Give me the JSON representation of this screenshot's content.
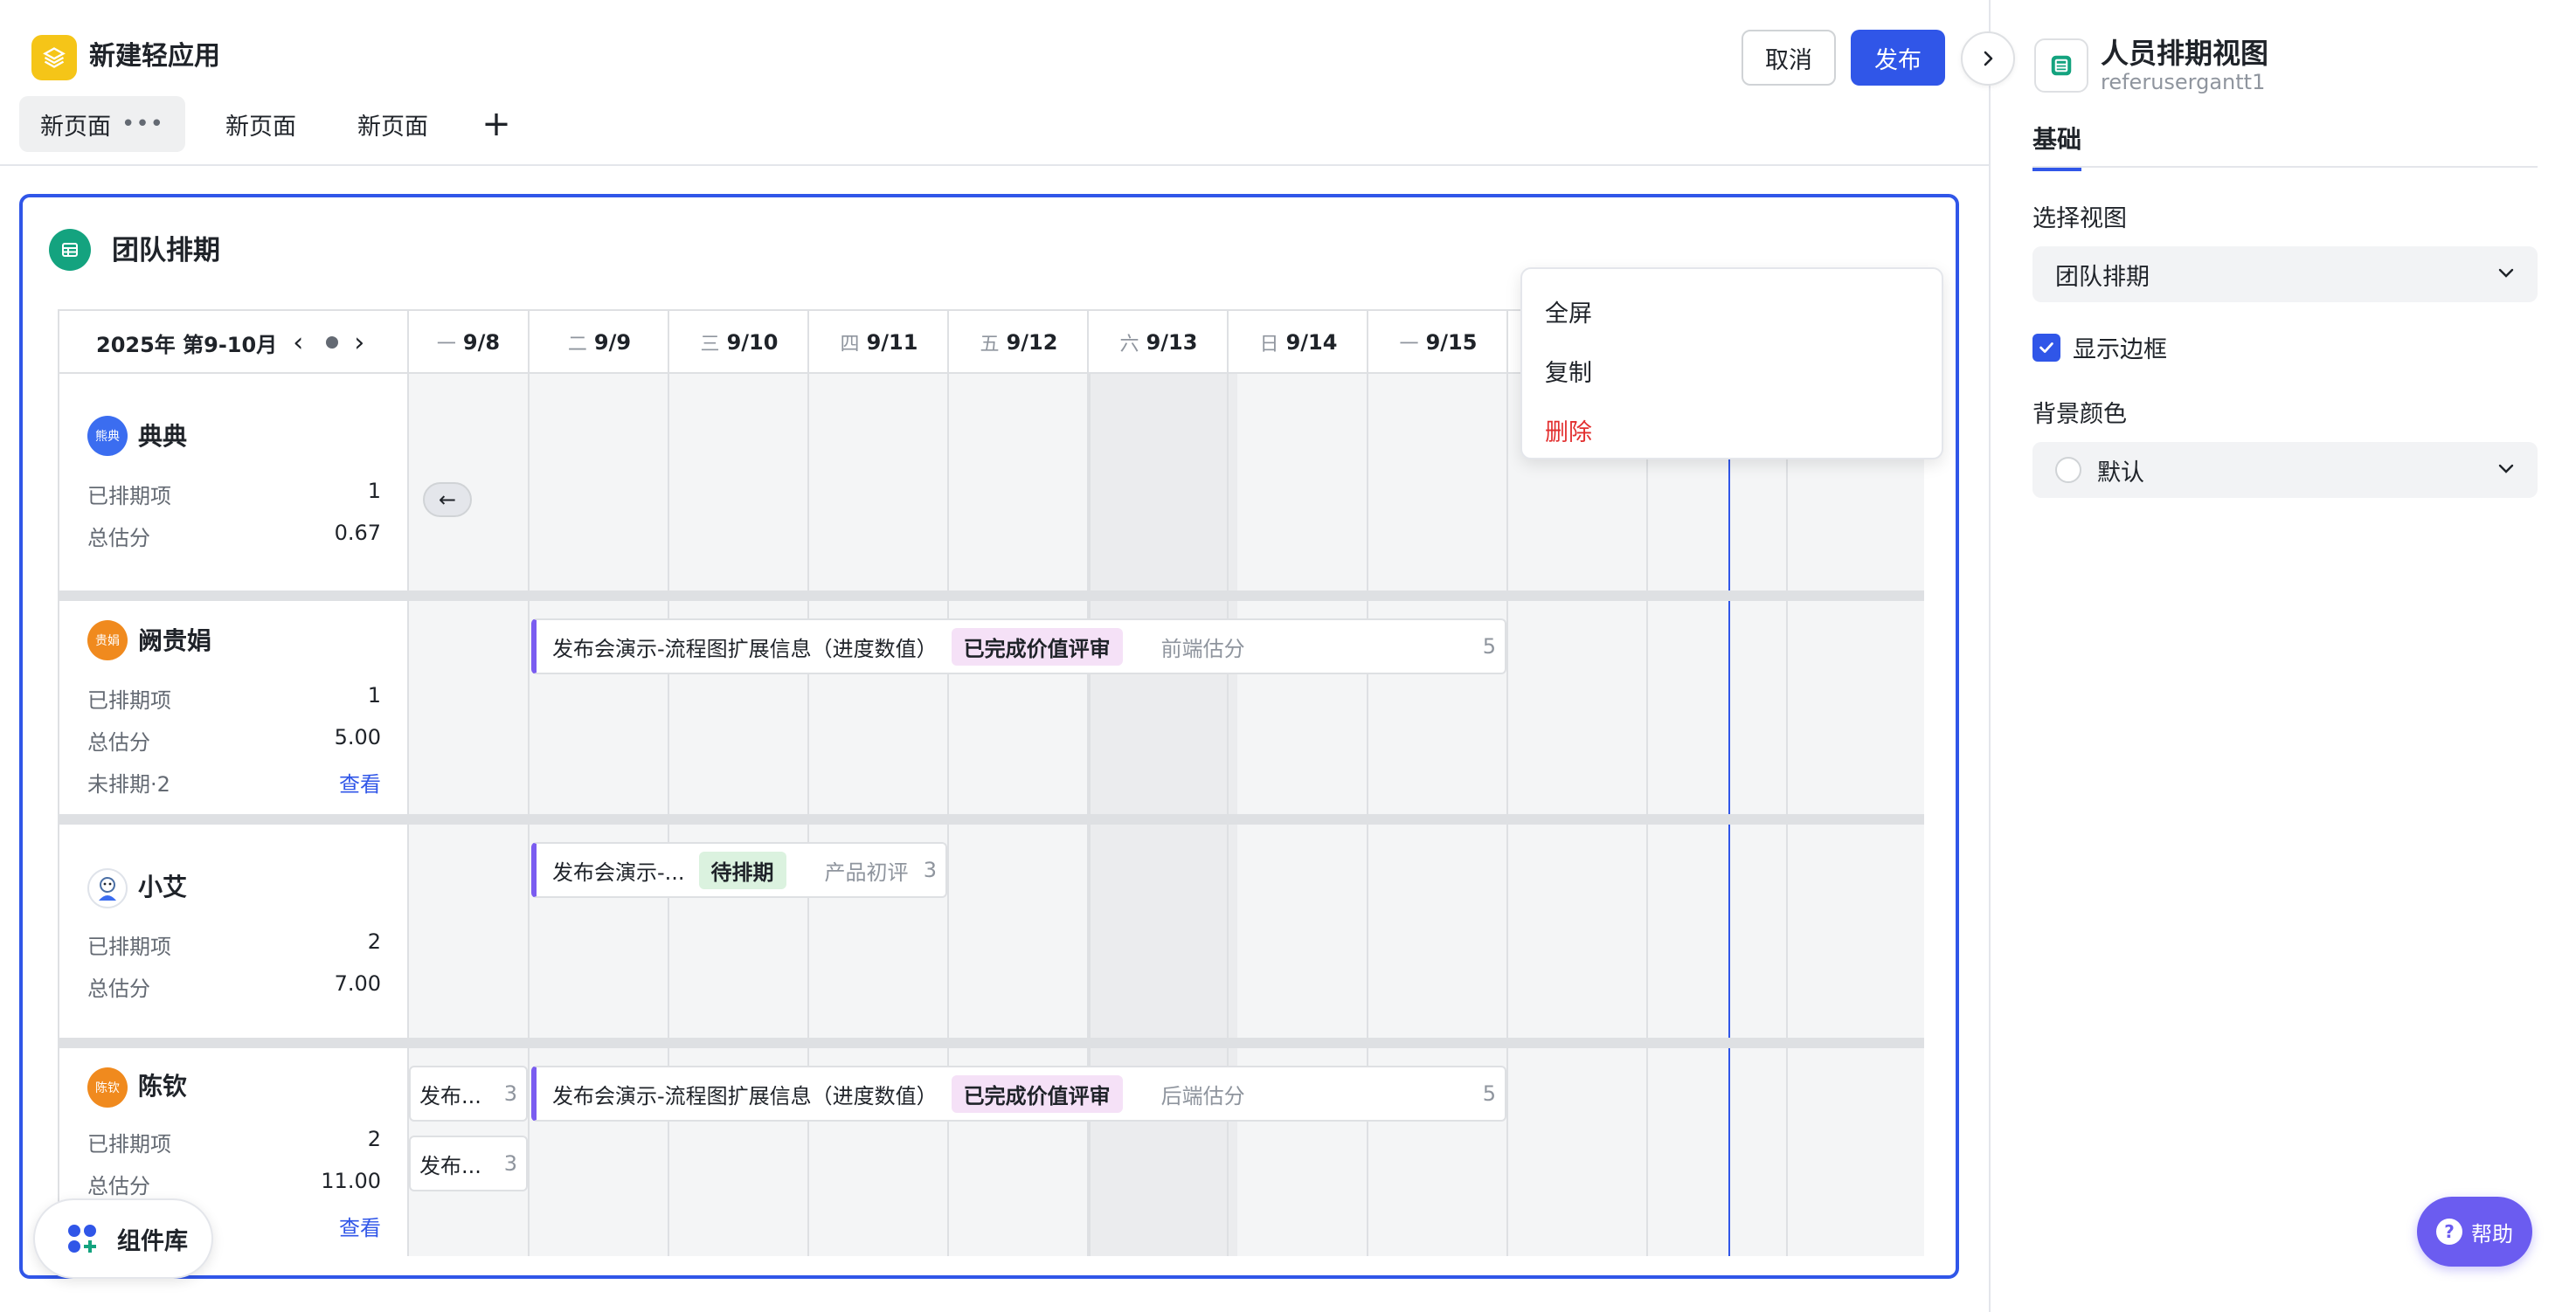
{
  "app": {
    "title": "新建轻应用",
    "cancel_label": "取消",
    "publish_label": "发布"
  },
  "pages": [
    {
      "label": "新页面",
      "menu": "•••"
    },
    {
      "label": "新页面"
    },
    {
      "label": "新页面"
    }
  ],
  "card": {
    "title": "团队排期"
  },
  "schedule": {
    "range_label": "2025年 第9-10月",
    "days": [
      {
        "weekday": "一",
        "date": "9/8"
      },
      {
        "weekday": "二",
        "date": "9/9"
      },
      {
        "weekday": "三",
        "date": "9/10"
      },
      {
        "weekday": "四",
        "date": "9/11"
      },
      {
        "weekday": "五",
        "date": "9/12"
      },
      {
        "weekday": "六",
        "date": "9/13"
      },
      {
        "weekday": "日",
        "date": "9/14"
      },
      {
        "weekday": "一",
        "date": "9/15"
      }
    ],
    "people": [
      {
        "name": "典典",
        "avatar_text": "熊典",
        "avatar_color": "#3b6df0",
        "scheduled_label": "已排期项",
        "scheduled": "1",
        "score_label": "总估分",
        "score": "0.67"
      },
      {
        "name": "阙贵娟",
        "avatar_text": "贵娟",
        "avatar_color": "#f08a1e",
        "scheduled_label": "已排期项",
        "scheduled": "1",
        "score_label": "总估分",
        "score": "5.00",
        "unscheduled_label": "未排期·2",
        "view_label": "查看"
      },
      {
        "name": "小艾",
        "avatar_text": "",
        "avatar_color": "#ffffff",
        "scheduled_label": "已排期项",
        "scheduled": "2",
        "score_label": "总估分",
        "score": "7.00"
      },
      {
        "name": "陈钦",
        "avatar_text": "陈钦",
        "avatar_color": "#f08a1e",
        "scheduled_label": "已排期项",
        "scheduled": "2",
        "score_label": "总估分",
        "score": "11.00",
        "view_label": "查看"
      }
    ],
    "bars": {
      "b1": {
        "title": "发布会演示-流程图扩展信息（进度数值）",
        "status": "已完成价值评审",
        "field": "前端估分",
        "num": "5"
      },
      "b2": {
        "title": "发布会演示-...",
        "status": "待排期",
        "field": "产品初评",
        "num": "3"
      },
      "b3": {
        "title": "发布会演示-流程图扩展信息（进度数值）",
        "status": "已完成价值评审",
        "field": "后端估分",
        "num": "5"
      },
      "b4": {
        "title": "发布...",
        "num": "3"
      },
      "b5": {
        "title": "发布...",
        "num": "3"
      }
    },
    "back_arrow": "←"
  },
  "context_menu": {
    "fullscreen": "全屏",
    "copy": "复制",
    "delete": "删除"
  },
  "component_library": {
    "label": "组件库"
  },
  "panel": {
    "title": "人员排期视图",
    "subtitle": "referusergantt1",
    "tab": "基础",
    "select_view_label": "选择视图",
    "select_view_value": "团队排期",
    "show_border_label": "显示边框",
    "show_border_checked": true,
    "bg_color_label": "背景颜色",
    "bg_color_value": "默认"
  },
  "help": {
    "label": "帮助"
  },
  "colors": {
    "accent": "#3056e8",
    "app_logo": "#f5c518",
    "component_icon": "#14a37f",
    "danger": "#e22f2f",
    "help": "#6b5cf0",
    "bar_accent": "#7a5cf0"
  }
}
